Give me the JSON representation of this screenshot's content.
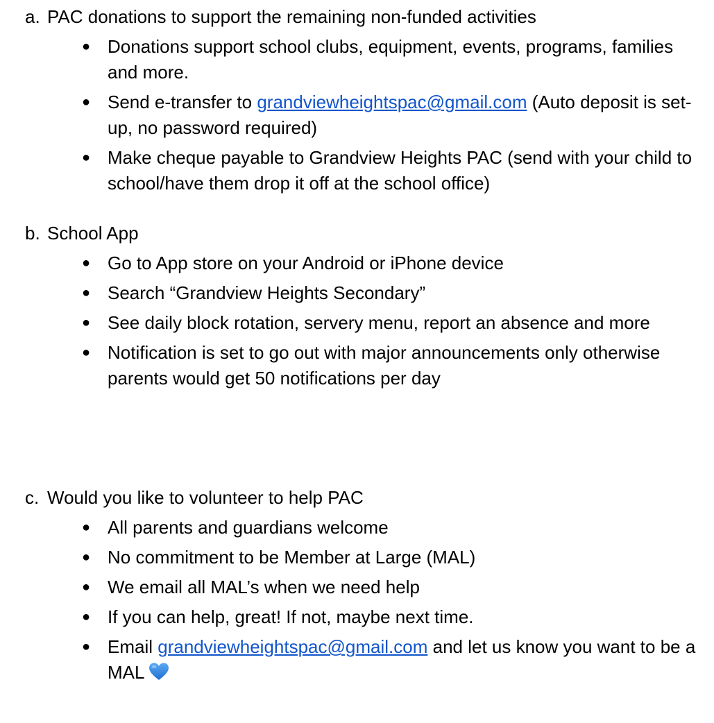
{
  "sections": [
    {
      "marker": "a.",
      "title": "PAC donations to support the remaining non-funded activities",
      "bullets": [
        {
          "text": "Donations support school clubs, equipment, events, programs, families and more."
        },
        {
          "pre": "Send e-transfer to ",
          "link": "grandviewheightspac@gmail.com",
          "post": " (Auto deposit is set-up, no password required)"
        },
        {
          "text": "Make cheque payable to Grandview Heights PAC (send with your child to school/have them drop it off at the school office)"
        }
      ]
    },
    {
      "marker": "b.",
      "title": "School App",
      "bullets": [
        {
          "text": "Go to App store on your Android or iPhone device"
        },
        {
          "text": "Search “Grandview Heights Secondary”"
        },
        {
          "text": "See daily block rotation, servery menu, report an absence and more"
        },
        {
          "text": "Notification is set to go out with major announcements only otherwise parents would get 50 notifications per day"
        }
      ]
    },
    {
      "marker": "c.",
      "title": "Would you like to volunteer to help PAC",
      "bullets": [
        {
          "text": "All parents and guardians welcome"
        },
        {
          "text": "No commitment to be Member at Large (MAL)"
        },
        {
          "text": "We email all MAL’s when we need help"
        },
        {
          "text": "If you can help, great! If not, maybe next time."
        },
        {
          "pre": "Email ",
          "link": "grandviewheightspac@gmail.com",
          "post": " and let us know you want to be a MAL",
          "emoji": "blue-heart-icon"
        }
      ]
    }
  ],
  "bullet_glyph": "●",
  "colors": {
    "text": "#000000",
    "link": "#1155cc",
    "heart": "#3a8ee6"
  }
}
